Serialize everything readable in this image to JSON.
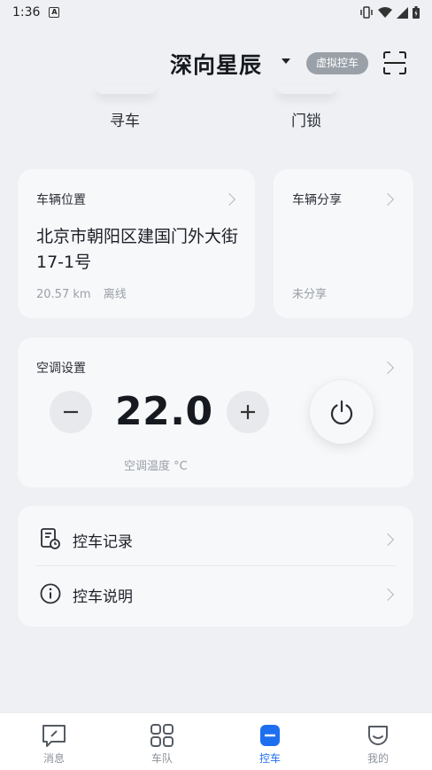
{
  "status_bar": {
    "time": "1:36",
    "badge": "A"
  },
  "header": {
    "title": "深向星辰",
    "badge": "虚拟控车"
  },
  "quick_actions": [
    {
      "label": "寻车"
    },
    {
      "label": "门锁"
    }
  ],
  "location_card": {
    "title": "车辆位置",
    "address": "北京市朝阳区建国门外大街17-1号",
    "distance": "20.57 km",
    "status": "离线"
  },
  "share_card": {
    "title": "车辆分享",
    "status": "未分享"
  },
  "ac_card": {
    "title": "空调设置",
    "temperature": "22.0",
    "temp_label": "空调温度 °C"
  },
  "menu": [
    {
      "label": "控车记录"
    },
    {
      "label": "控车说明"
    }
  ],
  "tabs": [
    {
      "label": "消息",
      "active": false
    },
    {
      "label": "车队",
      "active": false
    },
    {
      "label": "控车",
      "active": true
    },
    {
      "label": "我的",
      "active": false
    }
  ],
  "colors": {
    "accent": "#1e6ff0",
    "background": "#eef0f3",
    "card": "#f7f8fa"
  }
}
